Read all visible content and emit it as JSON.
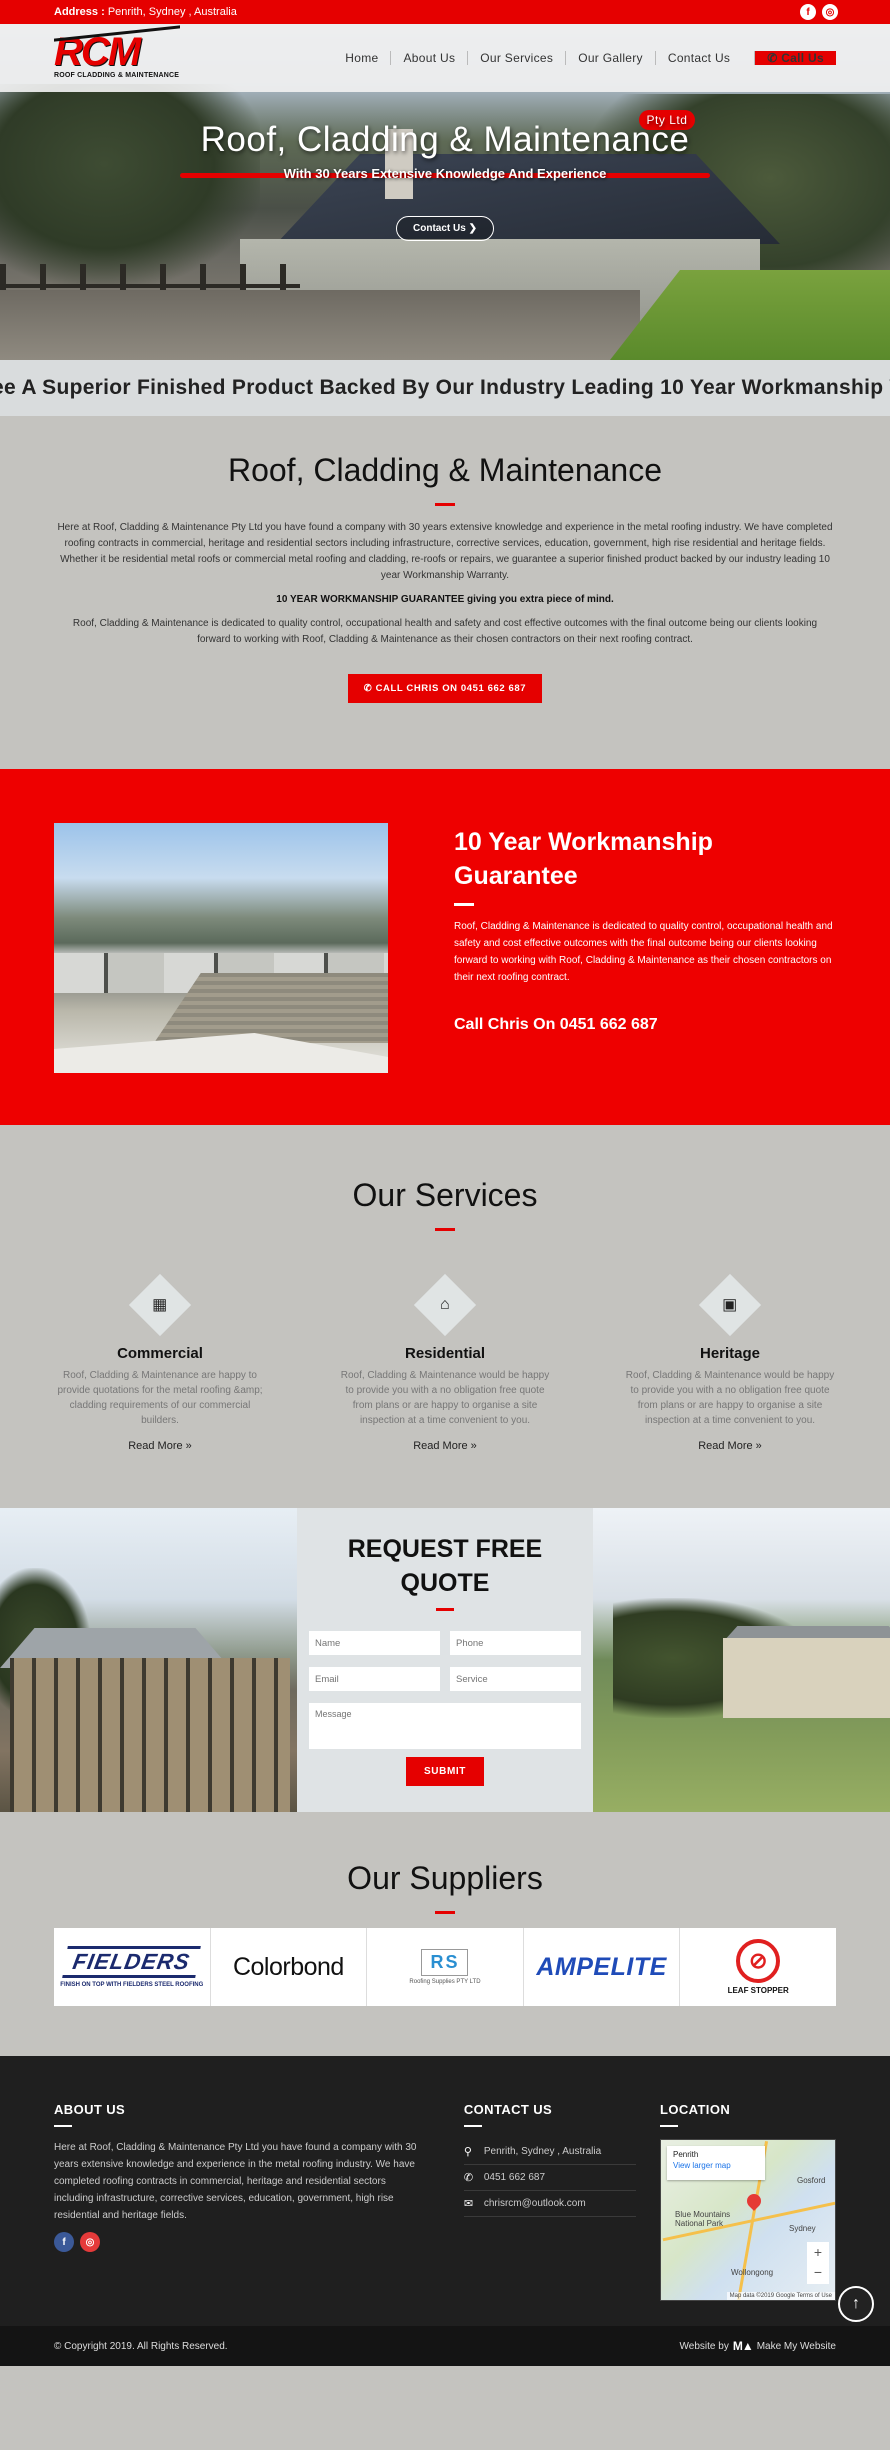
{
  "topbar": {
    "address_label": "Address :",
    "address_value": "Penrith, Sydney , Australia",
    "facebook_icon": "f",
    "instagram_icon": "◎"
  },
  "header": {
    "logo_text": "RCM",
    "logo_sub": "ROOF CLADDING & MAINTENANCE",
    "nav": [
      "Home",
      "About Us",
      "Our Services",
      "Our Gallery",
      "Contact Us"
    ],
    "call_label": "✆ Call Us"
  },
  "hero": {
    "title": "Roof, Cladding & Maintenance",
    "badge": "Pty Ltd",
    "subtitle": "With 30 Years Extensive Knowledge And Experience",
    "button": "Contact Us ❯"
  },
  "marquee": {
    "text": "ee A Superior Finished Product Backed By Our Industry Leading 10 Year Workmanship Wa"
  },
  "intro": {
    "title": "Roof, Cladding & Maintenance",
    "para1": "Here at Roof, Cladding & Maintenance Pty Ltd you have found a company with 30 years extensive knowledge and experience in the metal roofing industry.  We have completed roofing contracts in commercial, heritage and residential sectors including infrastructure, corrective services, education, government, high rise residential and heritage fields. Whether it be residential metal roofs or commercial metal roofing and cladding, re-roofs or repairs, we guarantee a superior finished product backed by our industry leading 10 year Workmanship Warranty.",
    "guarantee_line": "10 YEAR WORKMANSHIP GUARANTEE giving you extra piece of mind.",
    "para2": "Roof, Cladding & Maintenance is dedicated to quality control, occupational health and safety and cost effective outcomes with the final outcome being our clients looking forward to working with Roof, Cladding & Maintenance as their chosen contractors on their next roofing contract.",
    "button": "✆  CALL CHRIS ON 0451 662 687"
  },
  "guarantee": {
    "title": "10 Year Workmanship Guarantee",
    "text": "Roof, Cladding & Maintenance is dedicated to quality control, occupational health and safety and cost effective outcomes with the final outcome being our clients looking forward to working with Roof, Cladding & Maintenance as their chosen contractors on their next roofing contract.",
    "call": "Call Chris On 0451 662 687"
  },
  "services": {
    "title": "Our Services",
    "items": [
      {
        "icon": "▦",
        "title": "Commercial",
        "text": "Roof, Cladding & Maintenance are happy to provide quotations for the metal roofing &amp; cladding requirements of our commercial builders.",
        "more": "Read More »"
      },
      {
        "icon": "⌂",
        "title": "Residential",
        "text": "Roof, Cladding & Maintenance would be happy to provide you with a no obligation free quote from plans or are happy to organise a site inspection at a time convenient to you.",
        "more": "Read More »"
      },
      {
        "icon": "▣",
        "title": "Heritage",
        "text": "Roof, Cladding & Maintenance would be happy to provide you with a no obligation free quote from plans or are happy to organise a site inspection at a time convenient to you.",
        "more": "Read More »"
      }
    ]
  },
  "quote": {
    "title": "REQUEST FREE QUOTE",
    "name_ph": "Name",
    "phone_ph": "Phone",
    "email_ph": "Email",
    "service_ph": "Service",
    "message_ph": "Message",
    "submit": "SUBMIT"
  },
  "suppliers": {
    "title": "Our Suppliers",
    "fielders": "FIELDERS",
    "fielders_sub": "FINISH ON TOP WITH FIELDERS STEEL ROOFING",
    "colorbond": "Colorbond",
    "rs_mark": "RS",
    "rs_sub": "Roofing Supplies PTY LTD",
    "ampelite": "AMPELITE",
    "leafstopper": "LEAF STOPPER"
  },
  "footer": {
    "about_title": "ABOUT US",
    "about_text": "Here at Roof, Cladding & Maintenance Pty Ltd you have found a company with 30 years extensive knowledge and experience in the metal roofing industry. We have completed roofing contracts in commercial, heritage and residential sectors including infrastructure, corrective services, education, government, high rise residential and heritage fields.",
    "contact_title": "CONTACT US",
    "address": "Penrith, Sydney , Australia",
    "phone": "0451 662 687",
    "email": "chrisrcm@outlook.com",
    "location_title": "LOCATION",
    "map_place": "Penrith",
    "map_link": "View larger map",
    "map_label1": "Blue Mountains National Park",
    "map_label2": "Sydney",
    "map_label3": "Gosford",
    "map_label4": "Wollongong",
    "map_attr": "Map data ©2019 Google  Terms of Use"
  },
  "copybar": {
    "copyright": "© Copyright 2019. All Rights Reserved.",
    "website_by": "Website by",
    "mmw_mark": "M▲",
    "mmw_name": "Make My Website",
    "to_top": "↑"
  }
}
